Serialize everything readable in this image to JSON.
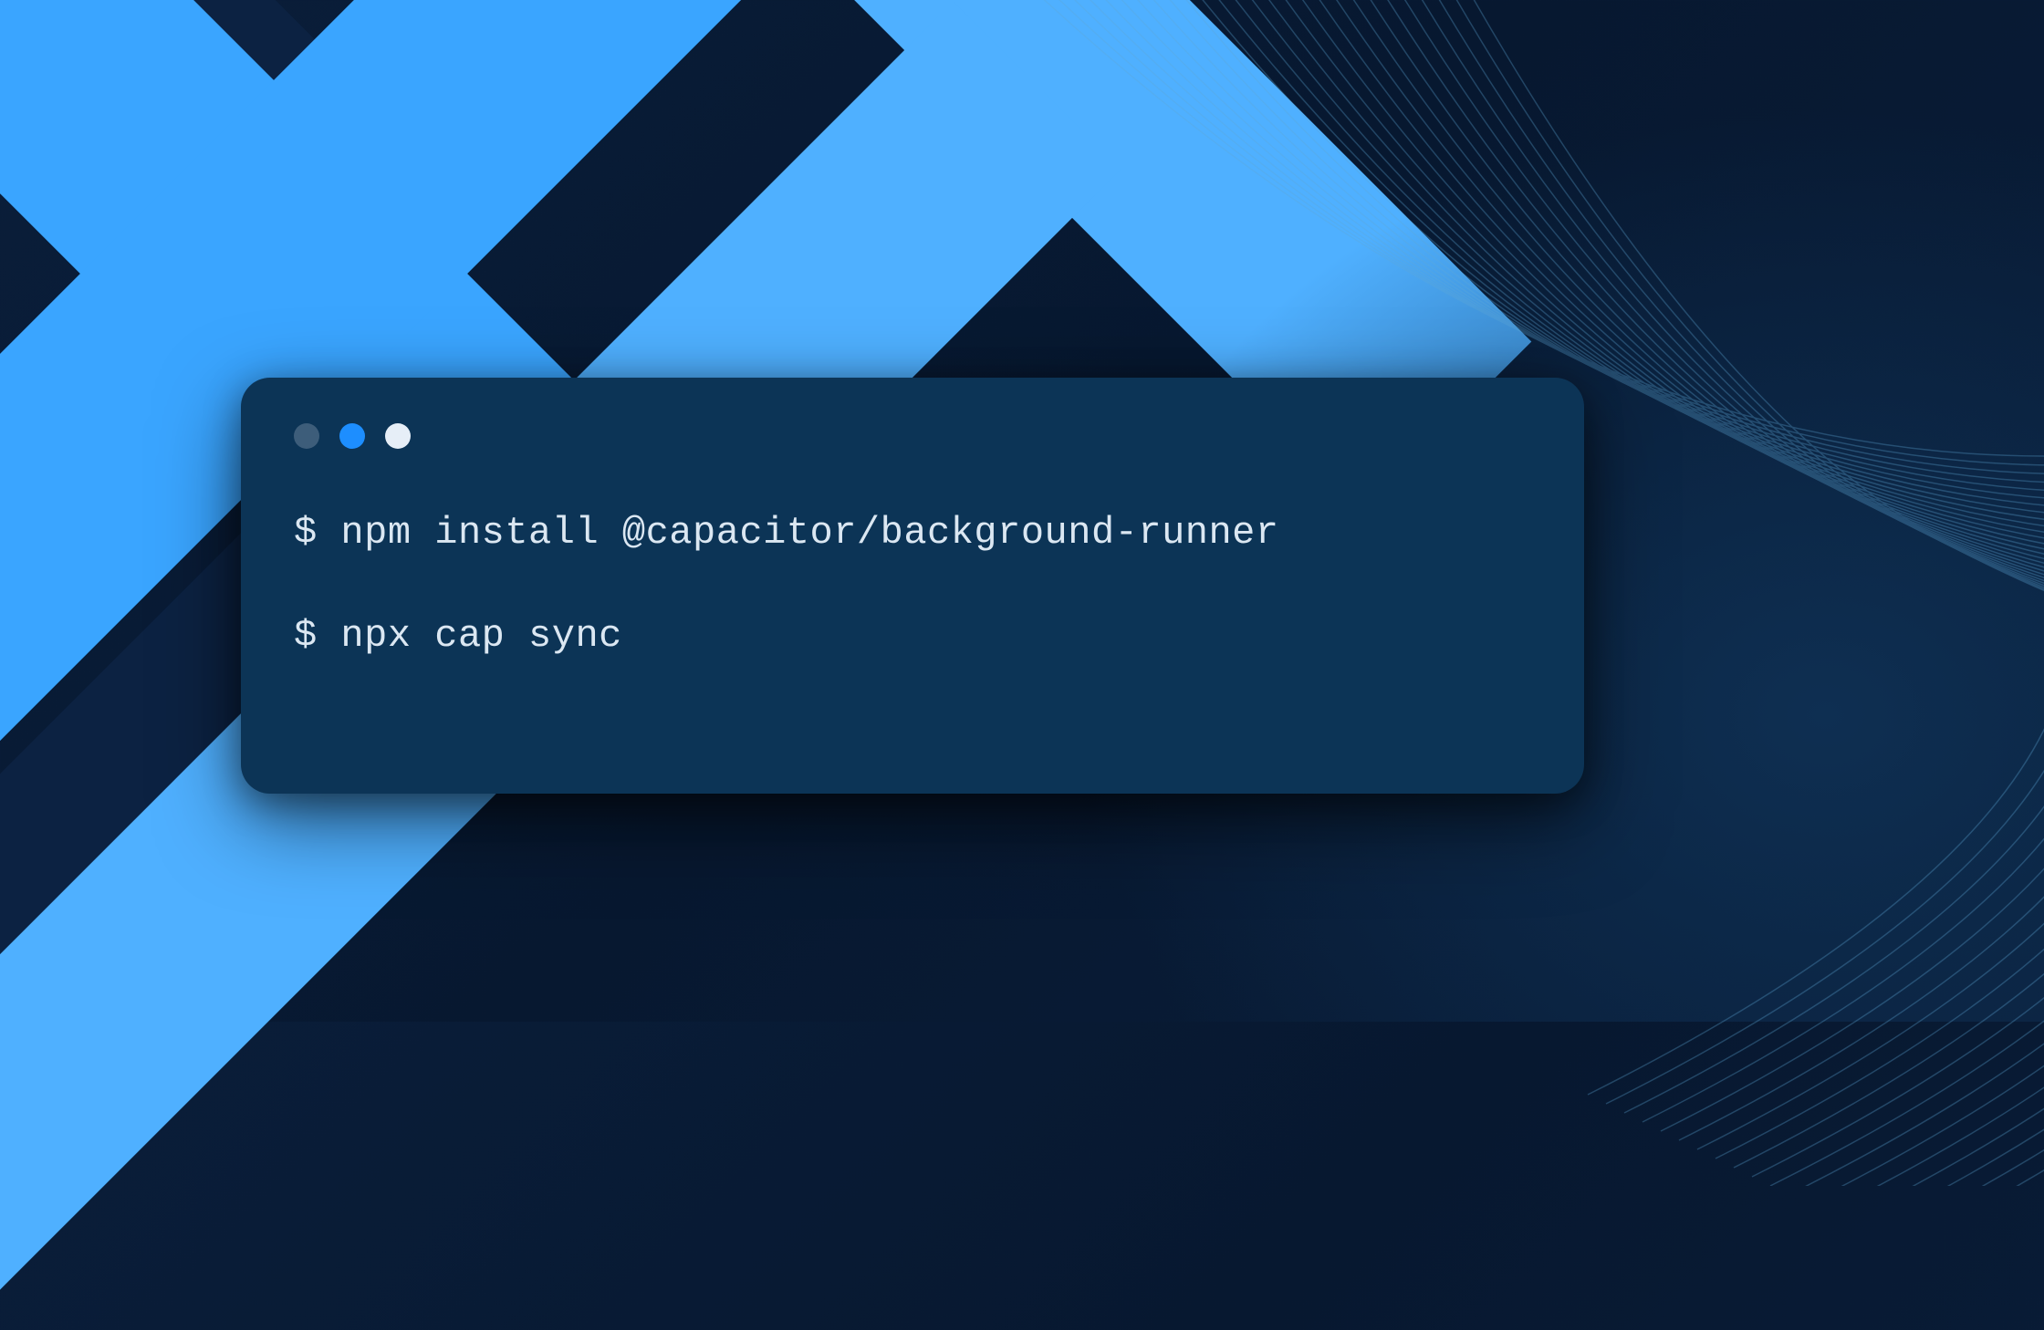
{
  "terminal": {
    "commands": [
      {
        "prompt": "$ ",
        "text": "npm install @capacitor/background-runner"
      },
      {
        "prompt": "$ ",
        "text": "npx cap sync"
      }
    ]
  },
  "colors": {
    "accent_light_blue": "#4fb0ff",
    "accent_blue": "#3aa5ff",
    "terminal_bg": "#0c3456",
    "terminal_text": "#dbe7f2",
    "dot_inactive": "#3d5d7a",
    "dot_blue": "#1d8eff",
    "dot_white": "#e6eef7",
    "background_dark": "#071830"
  }
}
